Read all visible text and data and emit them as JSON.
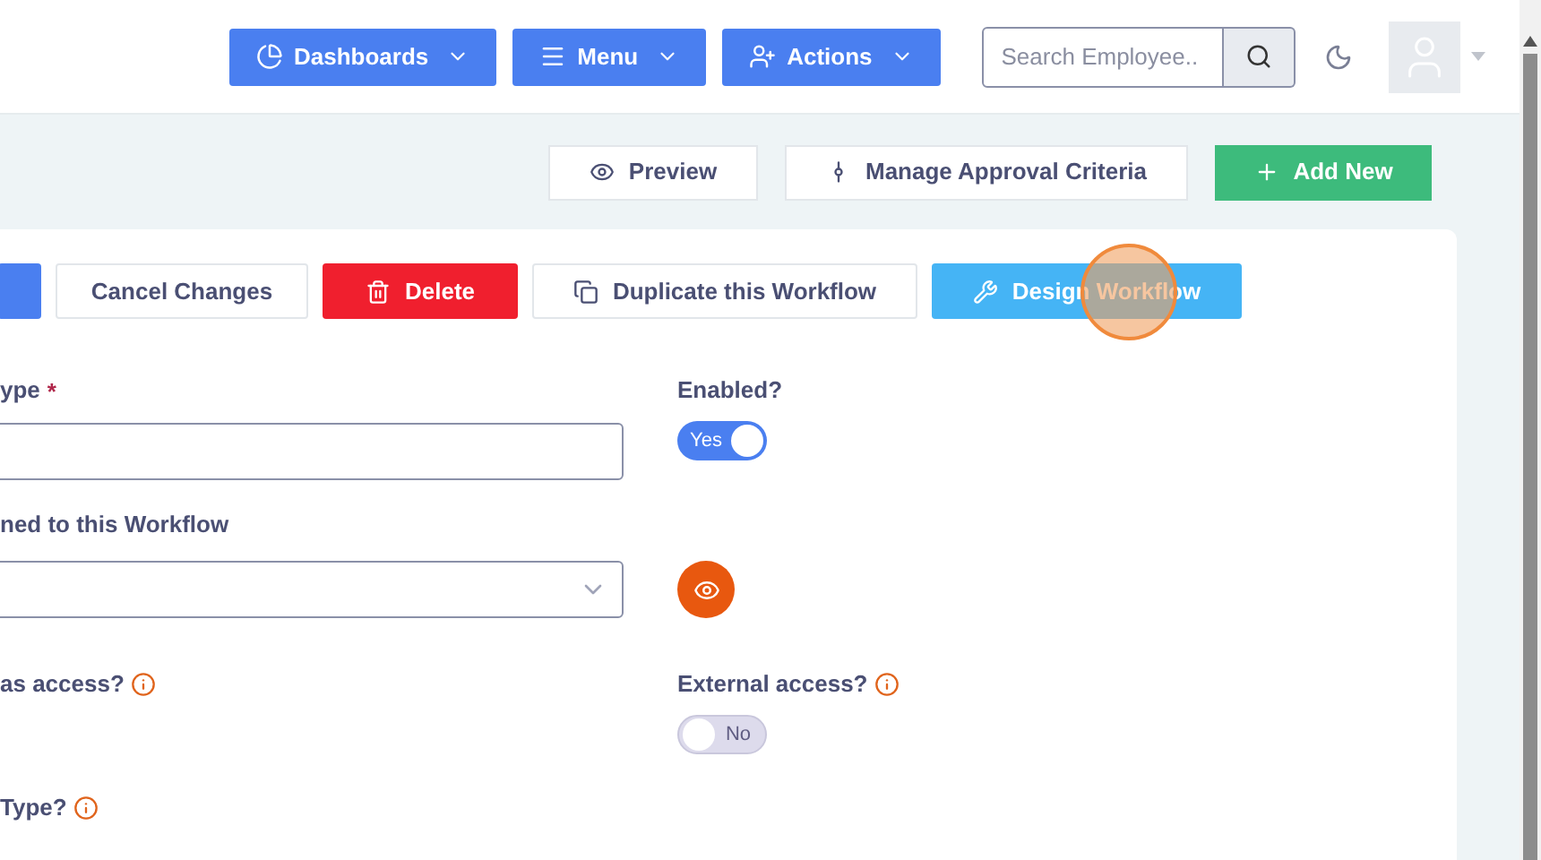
{
  "header": {
    "nav_buttons": [
      {
        "kind": "dashboards",
        "label": "Dashboards"
      },
      {
        "kind": "menu",
        "label": "Menu"
      },
      {
        "kind": "actions",
        "label": "Actions"
      }
    ],
    "search": {
      "placeholder": "Search Employee.."
    }
  },
  "toolbar": [
    {
      "kind": "preview",
      "label": "Preview"
    },
    {
      "kind": "approval",
      "label": "Manage Approval Criteria"
    },
    {
      "kind": "add",
      "label": "Add New"
    }
  ],
  "form_actions": [
    {
      "kind": "save"
    },
    {
      "kind": "cancel",
      "label": "Cancel Changes"
    },
    {
      "kind": "delete",
      "label": "Delete"
    },
    {
      "kind": "duplicate",
      "label": "Duplicate this Workflow"
    },
    {
      "kind": "design",
      "label": "Design Workflow"
    }
  ],
  "fields": [
    {
      "left": {
        "kind": "text",
        "label": "ype",
        "required_mark": "*"
      },
      "right": {
        "kind": "toggle",
        "label": "Enabled?",
        "on": true,
        "toggle_text": "Yes"
      }
    },
    {
      "left": {
        "kind": "select",
        "label": "ned to this Workflow"
      },
      "right": {
        "kind": "view"
      }
    },
    {
      "left": {
        "kind": "label",
        "label": "as access?",
        "info": true
      },
      "right": {
        "kind": "toggle",
        "label": "External access?",
        "info": true,
        "on": false,
        "toggle_text": "No"
      }
    },
    {
      "left": {
        "kind": "label",
        "label": "Type?",
        "info": true
      }
    }
  ]
}
